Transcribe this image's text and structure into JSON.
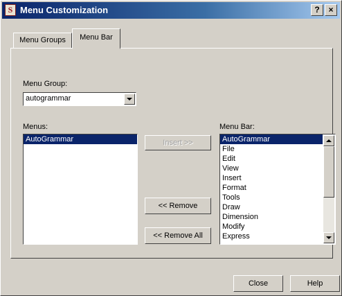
{
  "window": {
    "title": "Menu Customization",
    "help_glyph": "?",
    "close_glyph": "×",
    "icon_text": "S"
  },
  "tabs": [
    {
      "label": "Menu Groups",
      "active": false
    },
    {
      "label": "Menu Bar",
      "active": true
    }
  ],
  "menu_group": {
    "label": "Menu Group:",
    "value": "autogrammar"
  },
  "menus": {
    "label": "Menus:",
    "items": [
      "AutoGrammar"
    ],
    "selected": "AutoGrammar"
  },
  "menu_bar": {
    "label": "Menu Bar:",
    "items": [
      "AutoGrammar",
      "File",
      "Edit",
      "View",
      "Insert",
      "Format",
      "Tools",
      "Draw",
      "Dimension",
      "Modify",
      "Express"
    ],
    "selected": "AutoGrammar"
  },
  "buttons": {
    "insert": "Insert >>",
    "remove": "<< Remove",
    "remove_all": "<< Remove All",
    "close": "Close",
    "help": "Help"
  },
  "icons": [
    "app-icon",
    "help-icon",
    "close-icon",
    "dropdown-arrow-icon",
    "scroll-up-icon",
    "scroll-down-icon"
  ]
}
